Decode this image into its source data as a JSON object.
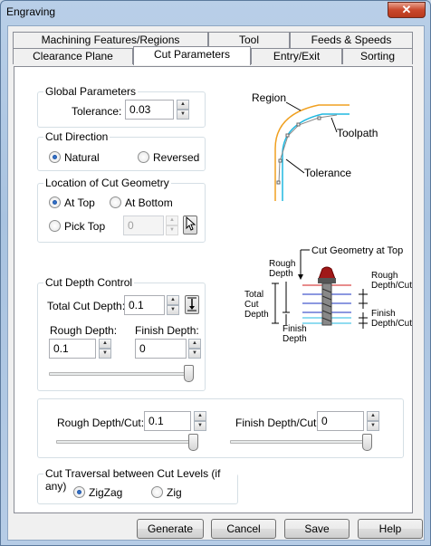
{
  "window": {
    "title": "Engraving",
    "close_glyph": "✕"
  },
  "tabs": {
    "row1": [
      "Machining Features/Regions",
      "Tool",
      "Feeds & Speeds"
    ],
    "row2": [
      "Clearance Plane",
      "Cut Parameters",
      "Entry/Exit",
      "Sorting"
    ],
    "active": "Cut Parameters"
  },
  "global": {
    "legend": "Global Parameters",
    "tolerance_label": "Tolerance:",
    "tolerance_value": "0.03"
  },
  "cut_direction": {
    "legend": "Cut Direction",
    "options": [
      "Natural",
      "Reversed"
    ],
    "selected": "Natural"
  },
  "location": {
    "legend": "Location of Cut Geometry",
    "options": [
      "At Top",
      "At Bottom",
      "Pick Top"
    ],
    "selected": "At Top",
    "pick_top_value": "0",
    "pick_icon": "cursor-arrow-icon"
  },
  "depth": {
    "legend": "Cut Depth Control",
    "total_label": "Total Cut Depth:",
    "total_value": "0.1",
    "rough_label": "Rough Depth:",
    "rough_value": "0.1",
    "finish_label": "Finish Depth:",
    "finish_value": "0",
    "slider_level": 1.0,
    "depth_icon": "depth-arrow-icon"
  },
  "per_cut": {
    "rough_label": "Rough Depth/Cut:",
    "rough_value": "0.1",
    "finish_label": "Finish Depth/Cut:",
    "finish_value": "0",
    "rough_slider_level": 1.0,
    "finish_slider_level": 1.0
  },
  "traversal": {
    "legend": "Cut Traversal between Cut Levels (if any)",
    "options": [
      "ZigZag",
      "Zig"
    ],
    "selected": "ZigZag"
  },
  "diagram1": {
    "region": "Region",
    "toolpath": "Toolpath",
    "tolerance": "Tolerance"
  },
  "diagram2": {
    "cut_geometry_top": "Cut Geometry at Top",
    "rough_depth_l1": "Rough",
    "rough_depth_l2": "Depth",
    "total_l1": "Total",
    "total_l2": "Cut",
    "total_l3": "Depth",
    "finish_l1": "Finish",
    "finish_l2": "Depth",
    "rough_cut_l1": "Rough",
    "rough_cut_l2": "Depth/Cut",
    "finish_cut_l1": "Finish",
    "finish_cut_l2": "Depth/Cut"
  },
  "buttons": {
    "generate": "Generate",
    "cancel": "Cancel",
    "save": "Save",
    "help": "Help"
  },
  "colors": {
    "region": "#f0a020",
    "toolpath": "#20b8e0",
    "tool_tip": "#a01818"
  }
}
